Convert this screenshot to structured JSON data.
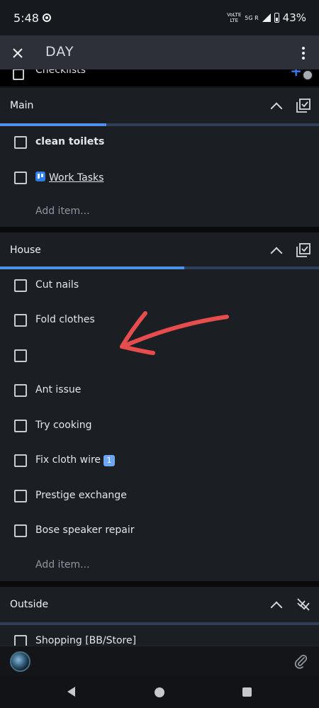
{
  "status_bar": {
    "time": "5:48",
    "volte_top": "VoLTE",
    "volte_bottom": "LTE",
    "network": "5G R",
    "battery": "43%"
  },
  "app_bar": {
    "title": "DAY",
    "close_icon": "close-icon",
    "more_icon": "more-vert-icon"
  },
  "partial_row": {
    "label": "Checklists",
    "plus": "+"
  },
  "sections": {
    "main": {
      "title": "Main",
      "progress_fraction": 0.333,
      "items": [
        {
          "label": "clean toilets",
          "checked": false
        },
        {
          "label": "Work Tasks",
          "checked": false,
          "icon": "trello-icon"
        }
      ],
      "add_item": "Add item..."
    },
    "house": {
      "title": "House",
      "progress_fraction": 0.578,
      "items": [
        {
          "label": "Cut nails",
          "checked": false
        },
        {
          "label": "Fold clothes",
          "checked": false
        },
        {
          "label": "",
          "checked": false
        },
        {
          "label": "Ant issue",
          "checked": false
        },
        {
          "label": "Try cooking",
          "checked": false
        },
        {
          "label": "Fix cloth wire",
          "checked": false,
          "badge": "1"
        },
        {
          "label": "Prestige exchange",
          "checked": false
        },
        {
          "label": "Bose speaker repair",
          "checked": false
        }
      ],
      "add_item": "Add item..."
    },
    "outside": {
      "title": "Outside",
      "items": [
        {
          "label": "Shopping [BB/Store]",
          "checked": false
        }
      ]
    }
  },
  "colors": {
    "accent": "#4e90ea",
    "annotation_arrow": "#e84d4d",
    "section_bg": "#1b1f24"
  },
  "icons": {
    "avatar": "avatar",
    "attach": "paperclip-icon"
  }
}
